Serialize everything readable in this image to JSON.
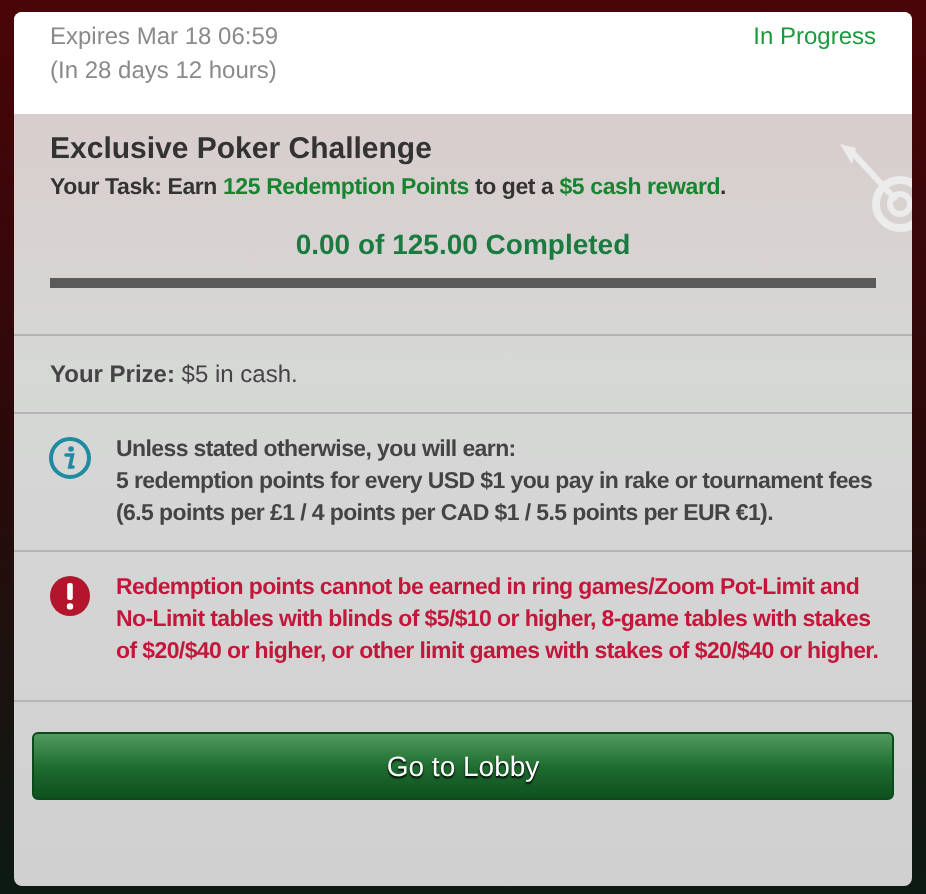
{
  "header": {
    "expires": "Expires Mar 18 06:59",
    "remaining": "(In 28 days 12 hours)",
    "status": "In Progress"
  },
  "challenge": {
    "title": "Exclusive Poker Challenge",
    "task": [
      {
        "text": "Your Task: Earn ",
        "highlight": false
      },
      {
        "text": "125 Redemption Points",
        "highlight": true
      },
      {
        "text": " to get a ",
        "highlight": false
      },
      {
        "text": "$5 cash reward",
        "highlight": true
      },
      {
        "text": ".",
        "highlight": false
      }
    ],
    "progress_text": "0.00 of 125.00 Completed",
    "level": 0
  },
  "prize": "**Your Prize:** $5 in cash.",
  "notices": [
    {
      "kind": "info",
      "lines": [
        "Unless stated otherwise, you will earn:",
        "5 redemption points for every USD $1 you pay in rake or tournament fees (6.5 points per £1 / 4 points per CAD $1 / 5.5 points per EUR €1)."
      ]
    },
    {
      "kind": "warning",
      "lines": [
        "Redemption points cannot be earned in ring games/Zoom Pot-Limit and No-Limit tables with blinds of $5/$10 or higher, 8-game tables with stakes of $20/$40 or higher, or other limit games with stakes of $20/$40 or higher."
      ]
    }
  ],
  "button": "Go to Lobby"
}
